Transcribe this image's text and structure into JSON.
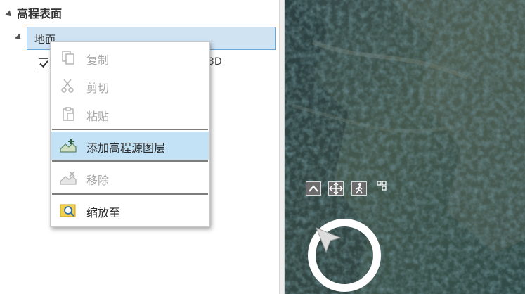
{
  "tree": {
    "header": "高程表面",
    "item": "地面",
    "peek_text": "3D"
  },
  "context_menu": {
    "copy": "复制",
    "cut": "剪切",
    "paste": "粘贴",
    "add_elevation_source": "添加高程源图层",
    "remove": "移除",
    "zoom_to": "缩放至"
  },
  "icons": {
    "copy": "copy-icon",
    "cut": "scissors-icon",
    "paste": "clipboard-icon",
    "add": "add-elevation-layer-icon",
    "remove": "remove-layer-icon",
    "zoom": "zoom-to-icon",
    "nav_up": "chevron-up-icon",
    "nav_pan": "pan-arrows-icon",
    "nav_walk": "walk-icon",
    "nav_expand": "expand-icon",
    "compass": "compass-icon"
  },
  "colors": {
    "highlight": "#c4e2f6",
    "selection": "#cfe3f3",
    "disabled_text": "#a5a5a5"
  }
}
